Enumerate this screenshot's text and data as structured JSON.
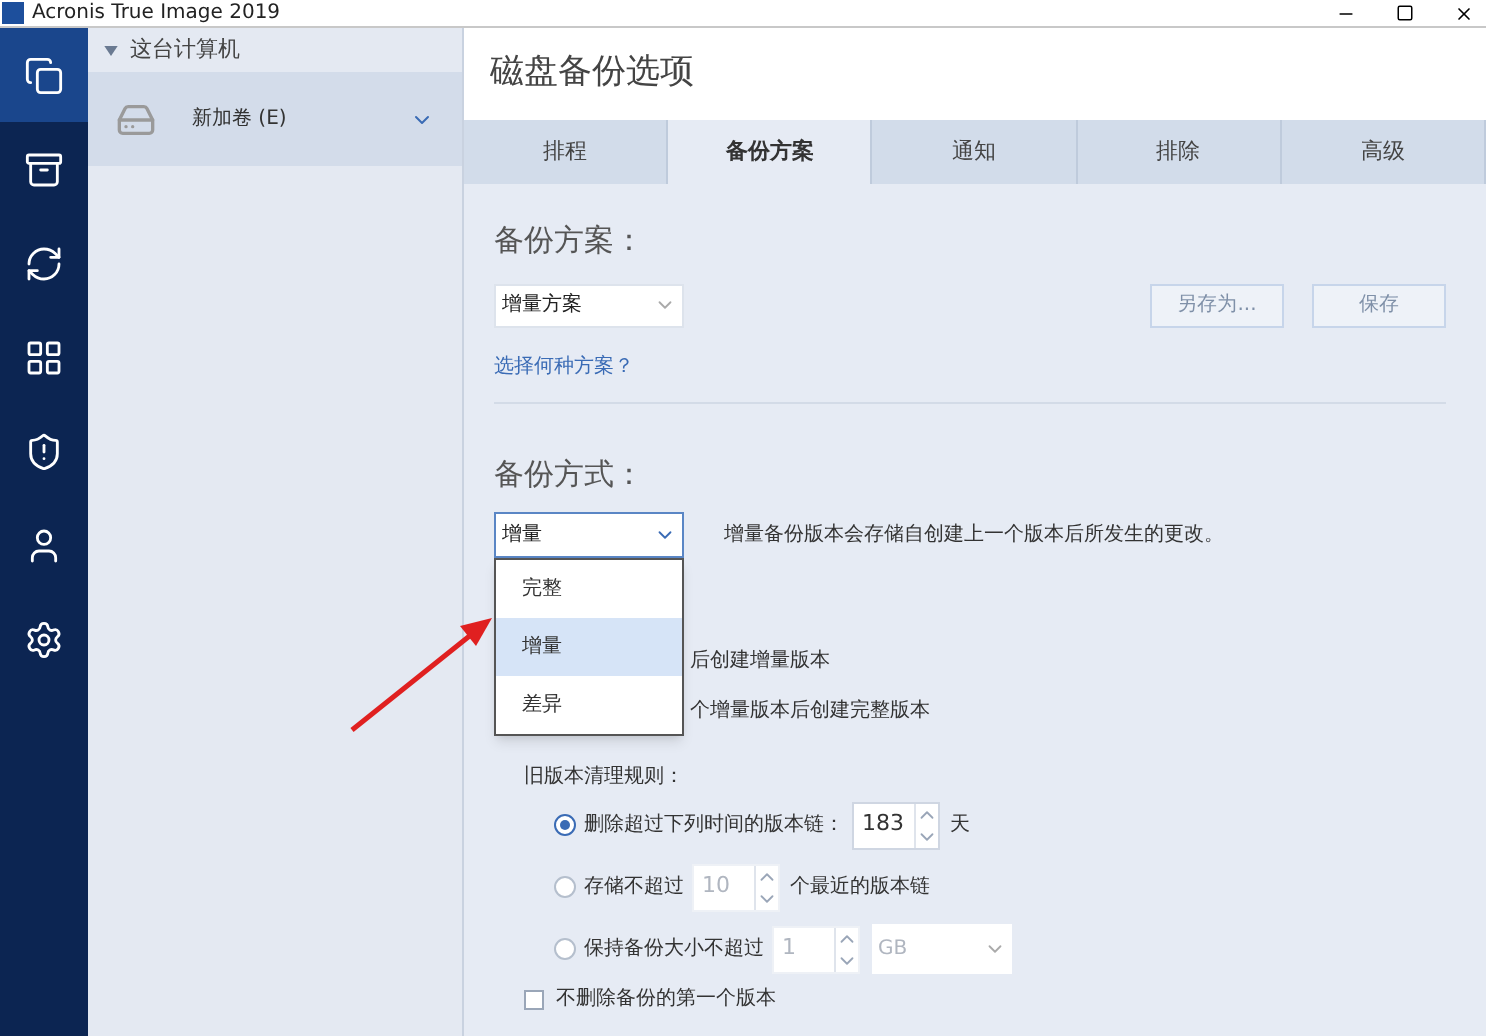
{
  "window": {
    "title": "Acronis True Image 2019"
  },
  "nav_items": [
    {
      "selected": true
    },
    {
      "selected": false
    },
    {
      "selected": false
    },
    {
      "selected": false
    },
    {
      "selected": false
    },
    {
      "selected": false
    },
    {
      "selected": false
    }
  ],
  "sidebar": {
    "section_label": "这台计算机",
    "expanded": true,
    "items": [
      {
        "label": "新加卷 (E)",
        "selected": true
      }
    ]
  },
  "page_title": "磁盘备份选项",
  "tabs": [
    {
      "label": "排程",
      "selected": false
    },
    {
      "label": "备份方案",
      "selected": true
    },
    {
      "label": "通知",
      "selected": false
    },
    {
      "label": "排除",
      "selected": false
    },
    {
      "label": "高级",
      "selected": false
    }
  ],
  "scheme": {
    "heading": "备份方案：",
    "select_value": "增量方案",
    "buttons": [
      {
        "label": "另存为...",
        "disabled": true
      },
      {
        "label": "保存",
        "disabled": true
      }
    ],
    "link": "选择何种方案？"
  },
  "method": {
    "heading": "备份方式：",
    "select_value": "增量",
    "description": "增量备份版本会存储自创建上一个版本后所发生的更改。",
    "menu_open": true,
    "menu_options": [
      {
        "label": "完整",
        "selected": false
      },
      {
        "label": "增量",
        "selected": true
      },
      {
        "label": "差异",
        "selected": false
      }
    ],
    "covered_options": [
      {
        "text": "后创建增量版本"
      },
      {
        "text": "个增量版本后创建完整版本"
      }
    ]
  },
  "cleanup": {
    "heading": "旧版本清理规则：",
    "options": [
      {
        "kind": "suffix",
        "label": "删除超过下列时间的版本链：",
        "selected": true,
        "disabled": false,
        "value": "183",
        "suffix": "天"
      },
      {
        "kind": "suffix",
        "label": "存储不超过",
        "selected": false,
        "disabled": true,
        "value": "10",
        "suffix": "个最近的版本链"
      },
      {
        "kind": "unit",
        "label": "保持备份大小不超过",
        "selected": false,
        "disabled": true,
        "value": "1",
        "unit": "GB"
      }
    ]
  },
  "keep_first": {
    "label": "不删除备份的第一个版本",
    "checked": false
  }
}
